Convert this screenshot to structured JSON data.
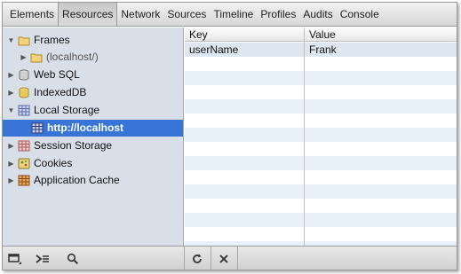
{
  "toolbar": {
    "tabs": [
      {
        "label": "Elements"
      },
      {
        "label": "Resources"
      },
      {
        "label": "Network"
      },
      {
        "label": "Sources"
      },
      {
        "label": "Timeline"
      },
      {
        "label": "Profiles"
      },
      {
        "label": "Audits"
      },
      {
        "label": "Console"
      }
    ],
    "selected_tab": "Resources"
  },
  "sidebar": {
    "items": [
      {
        "label": "Frames",
        "icon": "folder-icon",
        "expanded": true
      },
      {
        "label": "(localhost/)",
        "icon": "folder-icon",
        "expanded": false
      },
      {
        "label": "Web SQL",
        "icon": "database-icon",
        "expanded": false
      },
      {
        "label": "IndexedDB",
        "icon": "database-icon",
        "expanded": false
      },
      {
        "label": "Local Storage",
        "icon": "storage-grid-icon",
        "expanded": true
      },
      {
        "label": "http://localhost",
        "icon": "storage-grid-icon",
        "selected": true
      },
      {
        "label": "Session Storage",
        "icon": "session-storage-icon",
        "expanded": false
      },
      {
        "label": "Cookies",
        "icon": "cookie-icon",
        "expanded": false
      },
      {
        "label": "Application Cache",
        "icon": "app-cache-icon",
        "expanded": false
      }
    ]
  },
  "grid": {
    "columns": [
      "Key",
      "Value"
    ],
    "rows": [
      {
        "key": "userName",
        "value": "Frank"
      }
    ]
  },
  "statusbar": {
    "buttons": [
      "dock-icon",
      "console-icon",
      "search-icon",
      "refresh-icon",
      "delete-icon"
    ]
  },
  "colors": {
    "selection": "#3875d7",
    "sidebar_bg": "#d8dfe8",
    "row_alt": "#e8f0fa"
  }
}
